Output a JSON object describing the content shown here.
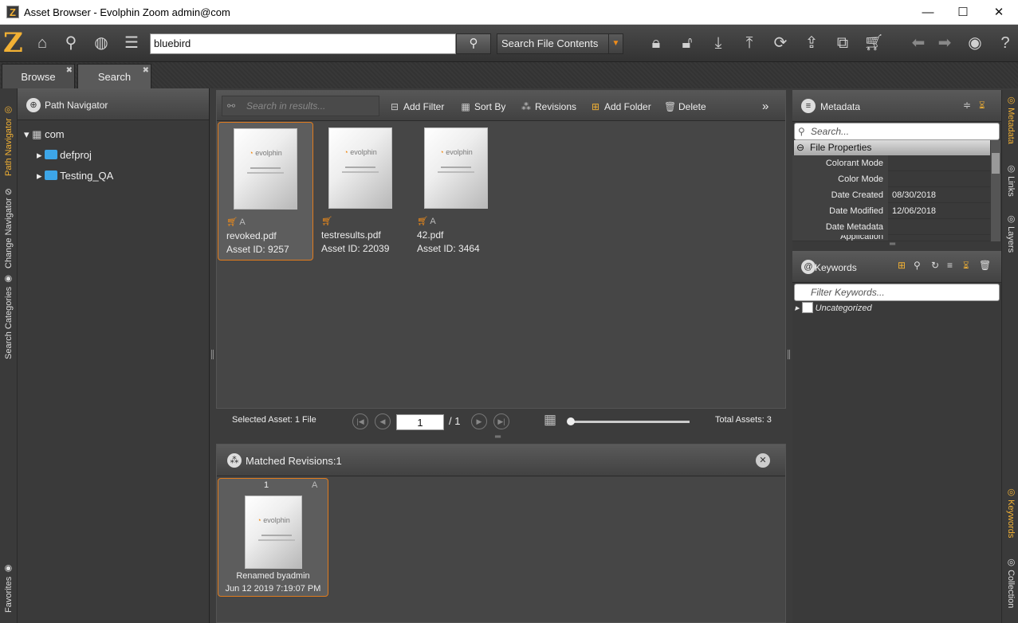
{
  "window": {
    "title": "Asset Browser - Evolphin Zoom admin@com",
    "minimize": "—",
    "maximize": "☐",
    "close": "✕"
  },
  "toolbar": {
    "logo": "Z",
    "search_value": "bluebird",
    "search_mode": "Search File Contents",
    "icons": [
      "home-icon",
      "search-icon",
      "globe-icon",
      "list-icon",
      "lock-icon",
      "unlock-icon",
      "download-icon",
      "upload-icon",
      "sync-icon",
      "export-icon",
      "copy-icon",
      "cart-icon",
      "back-icon",
      "forward-icon",
      "user-icon",
      "help-icon"
    ]
  },
  "tabs": [
    {
      "label": "Browse"
    },
    {
      "label": "Search"
    }
  ],
  "left_tabs": [
    "Path Navigator",
    "Change Navigator",
    "Search Categories",
    "Favorites"
  ],
  "path_navigator": {
    "title": "Path Navigator",
    "tree": [
      {
        "label": "com"
      },
      {
        "label": "defproj"
      },
      {
        "label": "Testing_QA"
      }
    ]
  },
  "results": {
    "search_placeholder": "Search in results...",
    "buttons": {
      "add_filter": "Add Filter",
      "sort_by": "Sort By",
      "revisions": "Revisions",
      "add_folder": "Add Folder",
      "delete": "Delete",
      "more": "»"
    },
    "assets": [
      {
        "name": "revoked.pdf",
        "id": "Asset ID: 9257",
        "selected": true
      },
      {
        "name": "testresults.pdf",
        "id": "Asset ID: 22039",
        "selected": false
      },
      {
        "name": "42.pdf",
        "id": "Asset ID: 3464",
        "selected": false
      }
    ],
    "thumb_brand": "evolphin"
  },
  "pager": {
    "selected": "Selected Asset: 1 File",
    "page": "1",
    "of": "/ 1",
    "total": "Total Assets: 3"
  },
  "matched": {
    "title": "Matched Revisions:1",
    "revision": {
      "number": "1",
      "line1": "Renamed byadmin",
      "line2": "Jun 12 2019 7:19:07 PM"
    }
  },
  "metadata": {
    "title": "Metadata",
    "search_placeholder": "Search...",
    "section": "File Properties",
    "rows": [
      {
        "key": "Colorant Mode",
        "value": ""
      },
      {
        "key": "Color Mode",
        "value": ""
      },
      {
        "key": "Date Created",
        "value": "08/30/2018"
      },
      {
        "key": "Date Modified",
        "value": "12/06/2018"
      },
      {
        "key": "Date Metadata",
        "value": ""
      },
      {
        "key": "Application",
        "value": ""
      }
    ]
  },
  "keywords": {
    "title": "Keywords",
    "filter_placeholder": "Filter Keywords...",
    "items": [
      "Uncategorized"
    ]
  },
  "right_tabs": [
    "Metadata",
    "Links",
    "Layers",
    "Keywords",
    "Collection"
  ],
  "colors": {
    "accent": "#f2b134",
    "orange": "#e07b1d",
    "bg": "#3c3c3c"
  }
}
